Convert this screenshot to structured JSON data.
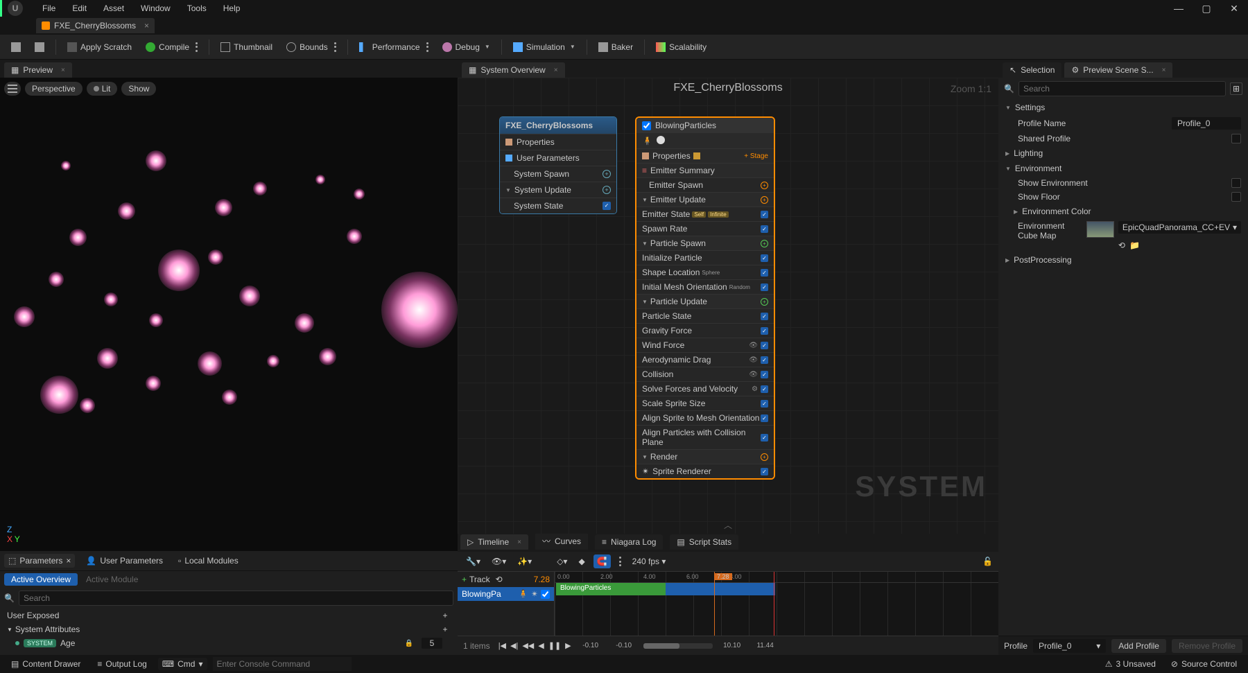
{
  "menu": {
    "items": [
      "File",
      "Edit",
      "Asset",
      "Window",
      "Tools",
      "Help"
    ]
  },
  "document": {
    "tab": "FXE_CherryBlossoms"
  },
  "toolbar": {
    "save": "",
    "browse": "",
    "applyScratch": "Apply Scratch",
    "compile": "Compile",
    "thumbnail": "Thumbnail",
    "bounds": "Bounds",
    "performance": "Performance",
    "debug": "Debug",
    "simulation": "Simulation",
    "baker": "Baker",
    "scalability": "Scalability"
  },
  "previewTab": "Preview",
  "viewport": {
    "perspective": "Perspective",
    "lit": "Lit",
    "show": "Show"
  },
  "paramTabs": {
    "parameters": "Parameters",
    "user": "User Parameters",
    "local": "Local Modules"
  },
  "paramSub": {
    "active": "Active Overview",
    "module": "Active Module"
  },
  "searchPlaceholder": "Search",
  "paramSections": {
    "userExposed": "User Exposed",
    "sysAttr": "System Attributes"
  },
  "sysRows": [
    {
      "chip": "SYSTEM",
      "name": "Age",
      "val": "5"
    }
  ],
  "overviewTab": "System Overview",
  "overview": {
    "title": "FXE_CherryBlossoms",
    "zoom": "Zoom 1:1",
    "watermark": "SYSTEM"
  },
  "nodeA": {
    "title": "FXE_CherryBlossoms",
    "rows": [
      {
        "icon": "props",
        "label": "Properties"
      },
      {
        "icon": "user",
        "label": "User Parameters"
      },
      {
        "sub": true,
        "label": "System Spawn",
        "add": true
      },
      {
        "sub": true,
        "tri": true,
        "label": "System Update",
        "add": true
      },
      {
        "sub": true,
        "label": "System State",
        "chk": true
      }
    ]
  },
  "nodeB": {
    "title": "BlowingParticles",
    "stage": "Stage",
    "sections": [
      {
        "t": "props",
        "label": "Properties",
        "warn": true,
        "stage": true
      },
      {
        "t": "hdr",
        "icon": "list",
        "label": "Emitter Summary"
      },
      {
        "t": "row",
        "indent": 1,
        "label": "Emitter Spawn",
        "ctrl": "addO"
      },
      {
        "t": "hdr",
        "tri": true,
        "label": "Emitter Update",
        "ctrl": "addO"
      },
      {
        "t": "row",
        "label": "Emitter State",
        "tags": [
          "Self",
          "Infinite"
        ],
        "ctrl": "chk"
      },
      {
        "t": "row",
        "label": "Spawn Rate",
        "ctrl": "chk"
      },
      {
        "t": "hdr",
        "tri": true,
        "label": "Particle Spawn",
        "ctrl": "add"
      },
      {
        "t": "row",
        "label": "Initialize Particle",
        "ctrl": "chk"
      },
      {
        "t": "row",
        "label": "Shape Location",
        "tags2": [
          "Sphere"
        ],
        "ctrl": "chk"
      },
      {
        "t": "row",
        "label": "Initial Mesh Orientation",
        "tags2": [
          "Random"
        ],
        "ctrl": "chk"
      },
      {
        "t": "hdr",
        "tri": true,
        "label": "Particle Update",
        "ctrl": "add"
      },
      {
        "t": "row",
        "label": "Particle State",
        "ctrl": "chk"
      },
      {
        "t": "row",
        "label": "Gravity Force",
        "ctrl": "chk"
      },
      {
        "t": "row",
        "label": "Wind Force",
        "eye": true,
        "ctrl": "chk"
      },
      {
        "t": "row",
        "label": "Aerodynamic Drag",
        "eye": true,
        "ctrl": "chk"
      },
      {
        "t": "row",
        "label": "Collision",
        "eye": true,
        "ctrl": "chk"
      },
      {
        "t": "row",
        "label": "Solve Forces and Velocity",
        "gear": true,
        "ctrl": "chk"
      },
      {
        "t": "row",
        "label": "Scale Sprite Size",
        "ctrl": "chk"
      },
      {
        "t": "row",
        "label": "Align Sprite to Mesh Orientation",
        "ctrl": "chk"
      },
      {
        "t": "row",
        "label": "Align Particles with Collision Plane",
        "ctrl": "chk"
      },
      {
        "t": "hdr",
        "tri": true,
        "label": "Render",
        "ctrl": "addO"
      },
      {
        "t": "row",
        "icon": "star",
        "label": "Sprite Renderer",
        "ctrl": "chk"
      }
    ]
  },
  "timelineTabs": {
    "tl": "Timeline",
    "cv": "Curves",
    "log": "Niagara Log",
    "ss": "Script Stats"
  },
  "timeline": {
    "fps": "240 fps",
    "track": "Track",
    "time": "7.28",
    "playhead": "7.28",
    "emitterShort": "BlowingPa",
    "emitterFull": "BlowingParticles",
    "ruler": [
      "0.00",
      "2.00",
      "4.00",
      "6.00",
      "8.00"
    ],
    "items": "1 items",
    "nums": [
      "-0.10",
      "-0.10",
      "10.10",
      "11.44"
    ]
  },
  "rightTabs": {
    "sel": "Selection",
    "scene": "Preview Scene S..."
  },
  "inspector": {
    "search": "Search",
    "settings": "Settings",
    "profileNameLbl": "Profile Name",
    "profileName": "Profile_0",
    "sharedLbl": "Shared Profile",
    "lighting": "Lighting",
    "env": "Environment",
    "showEnvLbl": "Show Environment",
    "showFloorLbl": "Show Floor",
    "envColor": "Environment Color",
    "envCube": "Environment Cube Map",
    "envCubeAsset": "EpicQuadPanorama_CC+EV",
    "post": "PostProcessing"
  },
  "profile": {
    "label": "Profile",
    "value": "Profile_0",
    "add": "Add Profile",
    "remove": "Remove Profile"
  },
  "status": {
    "drawer": "Content Drawer",
    "output": "Output Log",
    "cmd": "Cmd",
    "cmdPlaceholder": "Enter Console Command",
    "unsaved": "3 Unsaved",
    "source": "Source Control"
  }
}
